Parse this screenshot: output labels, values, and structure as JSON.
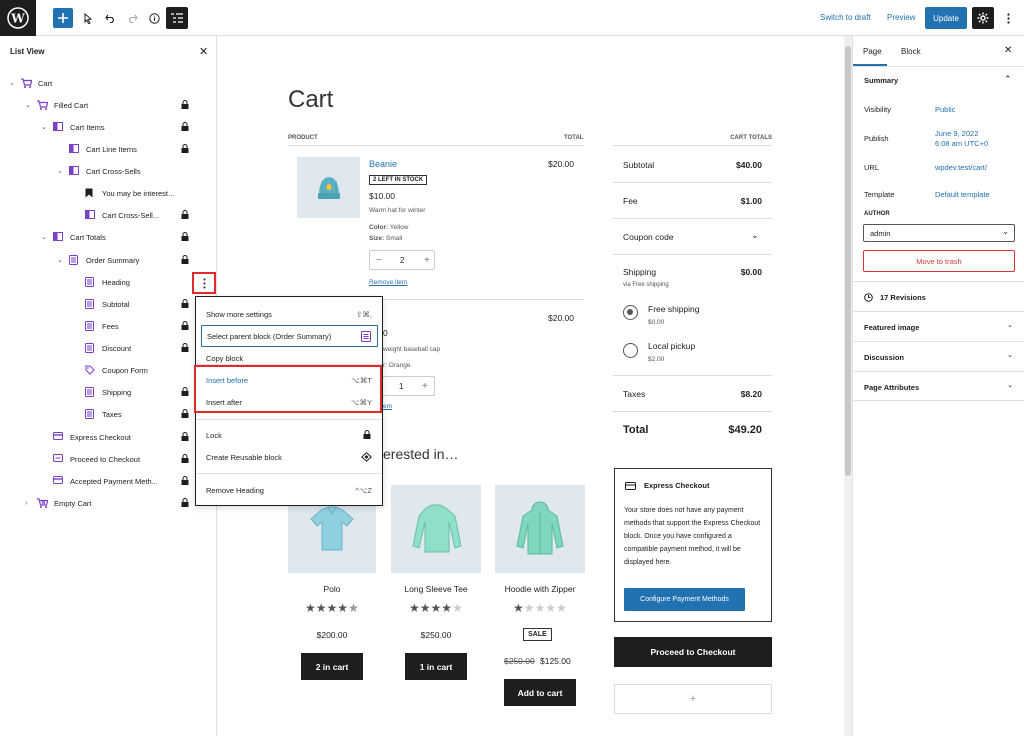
{
  "topbar": {
    "switch_to_draft": "Switch to draft",
    "preview": "Preview",
    "update": "Update"
  },
  "list_view": {
    "title": "List View",
    "items": [
      {
        "label": "Cart"
      },
      {
        "label": "Filled Cart"
      },
      {
        "label": "Cart Items"
      },
      {
        "label": "Cart Line Items"
      },
      {
        "label": "Cart Cross-Sells"
      },
      {
        "label": "You may be interest..."
      },
      {
        "label": "Cart Cross-Sell..."
      },
      {
        "label": "Cart Totals"
      },
      {
        "label": "Order Summary"
      },
      {
        "label": "Heading"
      },
      {
        "label": "Subtotal"
      },
      {
        "label": "Fees"
      },
      {
        "label": "Discount"
      },
      {
        "label": "Coupon Form"
      },
      {
        "label": "Shipping"
      },
      {
        "label": "Taxes"
      },
      {
        "label": "Express Checkout"
      },
      {
        "label": "Proceed to Checkout"
      },
      {
        "label": "Accepted Payment Meth..."
      },
      {
        "label": "Empty Cart"
      }
    ]
  },
  "context_menu": {
    "show_more": "Show more settings",
    "show_more_shortcut": "⇧⌘,",
    "select_parent": "Select parent block (Order Summary)",
    "copy_block": "Copy block",
    "insert_before": "Insert before",
    "insert_before_shortcut": "⌥⌘T",
    "insert_after": "Insert after",
    "insert_after_shortcut": "⌥⌘Y",
    "lock": "Lock",
    "create_reusable": "Create Reusable block",
    "remove_heading": "Remove Heading",
    "remove_shortcut": "^⌥Z"
  },
  "cart": {
    "title": "Cart",
    "col_product": "PRODUCT",
    "col_total": "TOTAL",
    "col_cart_totals": "CART TOTALS",
    "item1": {
      "name": "Beanie",
      "stock": "2 LEFT IN STOCK",
      "price": "$10.00",
      "desc": "Warm hat for winter",
      "color_label": "Color:",
      "color_value": "Yellow",
      "size_label": "Size:",
      "size_value": "Small",
      "qty": "2",
      "remove": "Remove item",
      "total": "$20.00"
    },
    "item2": {
      "price_partial": "0",
      "desc_partial": "weight baseball cap",
      "color_partial": "r: Orange",
      "qty": "1",
      "remove_partial": "em",
      "total": "$20.00"
    },
    "cross_sells_heading": "erested in…",
    "products": [
      {
        "name": "Polo",
        "price": "$200.00",
        "button": "2 in cart"
      },
      {
        "name": "Long Sleeve Tee",
        "price": "$250.00",
        "button": "1 in cart"
      },
      {
        "name": "Hoodie with Zipper",
        "sale": "SALE",
        "old_price": "$250.00",
        "price": "$125.00",
        "button": "Add to cart"
      }
    ],
    "ratings": [
      4.5,
      4,
      1
    ]
  },
  "totals": {
    "subtotal_label": "Subtotal",
    "subtotal": "$40.00",
    "fee_label": "Fee",
    "fee": "$1.00",
    "coupon": "Coupon code",
    "shipping_label": "Shipping",
    "shipping": "$0.00",
    "shipping_via": "via Free shipping",
    "free_shipping": "Free shipping",
    "free_shipping_price": "$0.00",
    "local_pickup": "Local pickup",
    "local_pickup_price": "$2.00",
    "taxes_label": "Taxes",
    "taxes": "$8.20",
    "total_label": "Total",
    "total": "$49.20"
  },
  "express": {
    "title": "Express Checkout",
    "body": "Your store does not have any payment methods that support the Express Checkout block. Once you have configured a compatible payment method, it will be displayed here.",
    "button": "Configure Payment Methods"
  },
  "proceed_button": "Proceed to Checkout",
  "add_block": "+",
  "sidebar": {
    "tab_page": "Page",
    "tab_block": "Block",
    "summary": "Summary",
    "visibility_label": "Visibility",
    "visibility": "Public",
    "publish_label": "Publish",
    "publish_line1": "June 9, 2022",
    "publish_line2": "6:08 am UTC+0",
    "url_label": "URL",
    "url": "wpdev.test/cart/",
    "template_label": "Template",
    "template": "Default template",
    "author_label": "AUTHOR",
    "author": "admin",
    "trash": "Move to trash",
    "revisions": "17 Revisions",
    "featured_image": "Featured image",
    "discussion": "Discussion",
    "page_attributes": "Page Attributes"
  },
  "colors": {
    "accent": "#2271b1",
    "highlight": "#e12a2a",
    "block_icon": "#7a3fc7"
  }
}
